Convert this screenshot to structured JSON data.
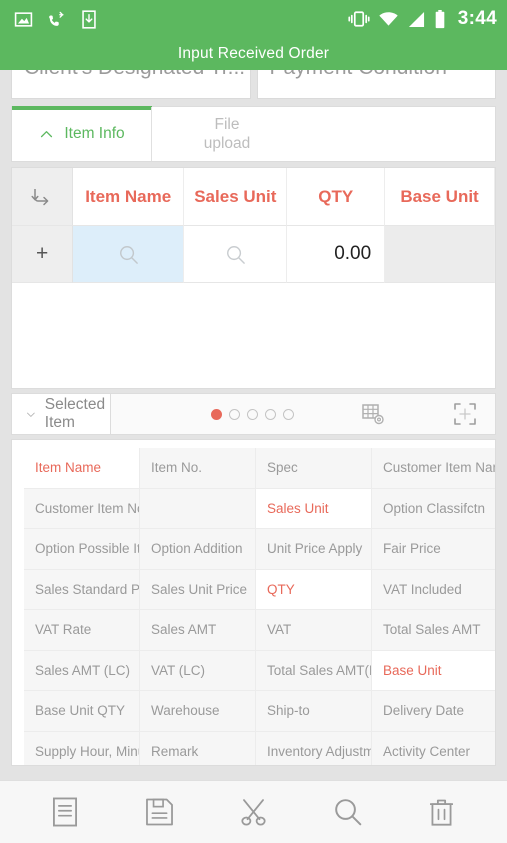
{
  "statusbar": {
    "time": "3:44",
    "left_icons": [
      "image-icon",
      "missed-call-icon",
      "download-to-device-icon"
    ],
    "right_icons": [
      "vibrate-icon",
      "wifi-icon",
      "signal-icon",
      "battery-icon"
    ]
  },
  "titlebar": {
    "title": "Input Received Order"
  },
  "top_fields": [
    {
      "label": "Client's Designated Tr..."
    },
    {
      "label": "Payment Condition"
    }
  ],
  "tabs": [
    {
      "label": "Item Info",
      "active": true,
      "icon": "chevron-up-icon"
    },
    {
      "label": "File\nupload",
      "label_line1": "File",
      "label_line2": "upload",
      "active": false
    }
  ],
  "item_table": {
    "corner_icon": "branch-arrow-icon",
    "add_label": "+",
    "columns": [
      "Item Name",
      "Sales Unit",
      "QTY",
      "Base Unit"
    ],
    "rows": [
      {
        "item_name": "",
        "item_name_icon": "search-icon",
        "sales_unit": "",
        "sales_unit_icon": "search-icon",
        "qty": "0.00",
        "base_unit": ""
      }
    ]
  },
  "selected_bar": {
    "label": "Selected Item",
    "collapse_icon": "chevron-down-icon",
    "pages": 5,
    "current_page": 1,
    "grid_settings_icon": "grid-settings-icon",
    "fullscreen_icon": "fullscreen-icon"
  },
  "detail_grid": {
    "rows": [
      [
        {
          "label": "Item Name",
          "required": true
        },
        {
          "label": "Item No.",
          "required": false
        },
        {
          "label": "Spec",
          "required": false
        },
        {
          "label": "Customer Item Nam",
          "required": false
        }
      ],
      [
        {
          "label": "Customer Item No.",
          "required": false
        },
        {
          "label": "",
          "required": false
        },
        {
          "label": "Sales Unit",
          "required": true
        },
        {
          "label": "Option Classifctn",
          "required": false
        }
      ],
      [
        {
          "label": "Option Possible Iter",
          "required": false
        },
        {
          "label": "Option Addition",
          "required": false
        },
        {
          "label": "Unit Price Apply",
          "required": false
        },
        {
          "label": "Fair Price",
          "required": false
        }
      ],
      [
        {
          "label": "Sales Standard Pric",
          "required": false
        },
        {
          "label": "Sales Unit Price",
          "required": false
        },
        {
          "label": "QTY",
          "required": true
        },
        {
          "label": "VAT Included",
          "required": false
        }
      ],
      [
        {
          "label": "VAT Rate",
          "required": false
        },
        {
          "label": "Sales AMT",
          "required": false
        },
        {
          "label": "VAT",
          "required": false
        },
        {
          "label": "Total Sales AMT",
          "required": false
        }
      ],
      [
        {
          "label": "Sales AMT (LC)",
          "required": false
        },
        {
          "label": "VAT (LC)",
          "required": false
        },
        {
          "label": "Total Sales AMT(LC",
          "required": false
        },
        {
          "label": "Base Unit",
          "required": true
        }
      ],
      [
        {
          "label": "Base Unit QTY",
          "required": false
        },
        {
          "label": "Warehouse",
          "required": false
        },
        {
          "label": "Ship-to",
          "required": false
        },
        {
          "label": "Delivery Date",
          "required": false
        }
      ],
      [
        {
          "label": "Supply Hour, Minute",
          "required": false
        },
        {
          "label": "Remark",
          "required": false
        },
        {
          "label": "Inventory Adjustmer",
          "required": false
        },
        {
          "label": "Activity Center",
          "required": false
        }
      ]
    ]
  },
  "bottom_toolbar": [
    {
      "name": "list-icon"
    },
    {
      "name": "save-icon"
    },
    {
      "name": "cut-icon"
    },
    {
      "name": "search-icon"
    },
    {
      "name": "delete-icon"
    }
  ],
  "colors": {
    "accent_green": "#5cb85f",
    "required_red": "#e8695a",
    "selected_cell_blue": "#ddeefa",
    "page_bg": "#e3e3e3"
  }
}
